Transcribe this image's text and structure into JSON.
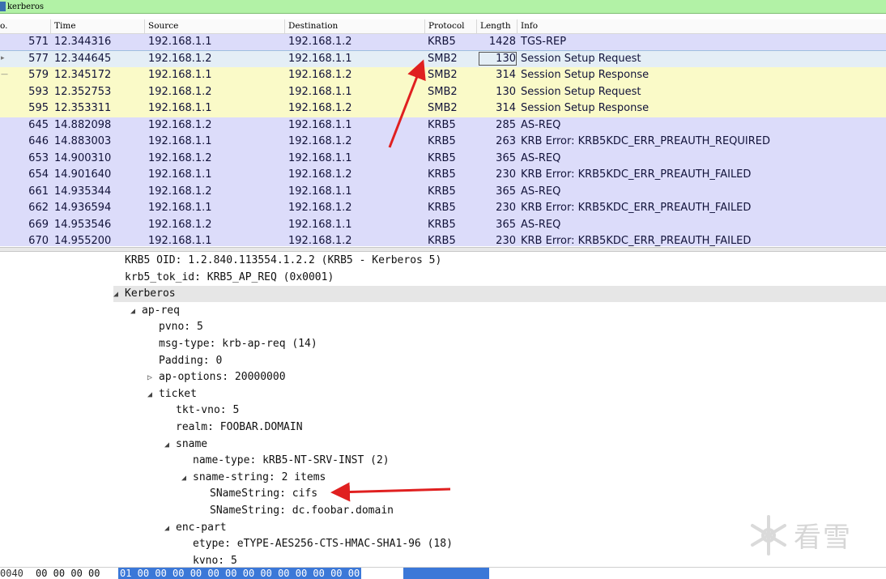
{
  "filter": {
    "value": "kerberos"
  },
  "columns": [
    {
      "label": "o."
    },
    {
      "label": "Time"
    },
    {
      "label": "Source"
    },
    {
      "label": "Destination"
    },
    {
      "label": "Protocol"
    },
    {
      "label": "Length"
    },
    {
      "label": "Info"
    }
  ],
  "packets": [
    {
      "no": "571",
      "time": "12.344316",
      "src": "192.168.1.1",
      "dst": "192.168.1.2",
      "proto": "KRB5",
      "len": "1428",
      "info": "TGS-REP",
      "bg": "#dcdcfa",
      "mark": ""
    },
    {
      "no": "577",
      "time": "12.344645",
      "src": "192.168.1.2",
      "dst": "192.168.1.1",
      "proto": "SMB2",
      "len": "130",
      "info": "Session Setup Request",
      "bg": "#e4eef6",
      "mark": "▸"
    },
    {
      "no": "579",
      "time": "12.345172",
      "src": "192.168.1.1",
      "dst": "192.168.1.2",
      "proto": "SMB2",
      "len": "314",
      "info": "Session Setup Response",
      "bg": "#fafac8",
      "mark": "—"
    },
    {
      "no": "593",
      "time": "12.352753",
      "src": "192.168.1.2",
      "dst": "192.168.1.1",
      "proto": "SMB2",
      "len": "130",
      "info": "Session Setup Request",
      "bg": "#fafac8",
      "mark": ""
    },
    {
      "no": "595",
      "time": "12.353311",
      "src": "192.168.1.1",
      "dst": "192.168.1.2",
      "proto": "SMB2",
      "len": "314",
      "info": "Session Setup Response",
      "bg": "#fafac8",
      "mark": ""
    },
    {
      "no": "645",
      "time": "14.882098",
      "src": "192.168.1.2",
      "dst": "192.168.1.1",
      "proto": "KRB5",
      "len": "285",
      "info": "AS-REQ",
      "bg": "#dcdcfa",
      "mark": ""
    },
    {
      "no": "646",
      "time": "14.883003",
      "src": "192.168.1.1",
      "dst": "192.168.1.2",
      "proto": "KRB5",
      "len": "263",
      "info": "KRB Error: KRB5KDC_ERR_PREAUTH_REQUIRED",
      "bg": "#dcdcfa",
      "mark": ""
    },
    {
      "no": "653",
      "time": "14.900310",
      "src": "192.168.1.2",
      "dst": "192.168.1.1",
      "proto": "KRB5",
      "len": "365",
      "info": "AS-REQ",
      "bg": "#dcdcfa",
      "mark": ""
    },
    {
      "no": "654",
      "time": "14.901640",
      "src": "192.168.1.1",
      "dst": "192.168.1.2",
      "proto": "KRB5",
      "len": "230",
      "info": "KRB Error: KRB5KDC_ERR_PREAUTH_FAILED",
      "bg": "#dcdcfa",
      "mark": ""
    },
    {
      "no": "661",
      "time": "14.935344",
      "src": "192.168.1.2",
      "dst": "192.168.1.1",
      "proto": "KRB5",
      "len": "365",
      "info": "AS-REQ",
      "bg": "#dcdcfa",
      "mark": ""
    },
    {
      "no": "662",
      "time": "14.936594",
      "src": "192.168.1.1",
      "dst": "192.168.1.2",
      "proto": "KRB5",
      "len": "230",
      "info": "KRB Error: KRB5KDC_ERR_PREAUTH_FAILED",
      "bg": "#dcdcfa",
      "mark": ""
    },
    {
      "no": "669",
      "time": "14.953546",
      "src": "192.168.1.2",
      "dst": "192.168.1.1",
      "proto": "KRB5",
      "len": "365",
      "info": "AS-REQ",
      "bg": "#dcdcfa",
      "mark": ""
    },
    {
      "no": "670",
      "time": "14.955200",
      "src": "192.168.1.1",
      "dst": "192.168.1.2",
      "proto": "KRB5",
      "len": "230",
      "info": "KRB Error: KRB5KDC_ERR_PREAUTH_FAILED",
      "bg": "#dcdcfa",
      "mark": ""
    }
  ],
  "selected_packet_no": "577",
  "tree": [
    {
      "text": "KRB5 OID: 1.2.840.113554.1.2.2 (KRB5 - Kerberos 5)",
      "depth": 0,
      "arrow": ""
    },
    {
      "text": "krb5_tok_id: KRB5_AP_REQ (0x0001)",
      "depth": 0,
      "arrow": ""
    },
    {
      "text": "Kerberos",
      "depth": 0,
      "arrow": "◢",
      "highlight": true
    },
    {
      "text": "ap-req",
      "depth": 1,
      "arrow": "◢"
    },
    {
      "text": "pvno: 5",
      "depth": 2,
      "arrow": ""
    },
    {
      "text": "msg-type: krb-ap-req (14)",
      "depth": 2,
      "arrow": ""
    },
    {
      "text": "Padding: 0",
      "depth": 2,
      "arrow": ""
    },
    {
      "text": "ap-options: 20000000",
      "depth": 2,
      "arrow": "▷"
    },
    {
      "text": "ticket",
      "depth": 2,
      "arrow": "◢"
    },
    {
      "text": "tkt-vno: 5",
      "depth": 3,
      "arrow": ""
    },
    {
      "text": "realm: FOOBAR.DOMAIN",
      "depth": 3,
      "arrow": ""
    },
    {
      "text": "sname",
      "depth": 3,
      "arrow": "◢"
    },
    {
      "text": "name-type: kRB5-NT-SRV-INST (2)",
      "depth": 4,
      "arrow": ""
    },
    {
      "text": "sname-string: 2 items",
      "depth": 4,
      "arrow": "◢"
    },
    {
      "text": "SNameString: cifs",
      "depth": 5,
      "arrow": ""
    },
    {
      "text": "SNameString: dc.foobar.domain",
      "depth": 5,
      "arrow": ""
    },
    {
      "text": "enc-part",
      "depth": 3,
      "arrow": "◢"
    },
    {
      "text": "etype: eTYPE-AES256-CTS-HMAC-SHA1-96 (18)",
      "depth": 4,
      "arrow": ""
    },
    {
      "text": "kvno: 5",
      "depth": 4,
      "arrow": ""
    }
  ],
  "hex": {
    "offset": "0040",
    "bytes": "00 00 00 00",
    "selected": "01 00 00 00 00 00 00 00 00 00 00 00 00 00"
  },
  "watermark": {
    "text": "看雪",
    "icon": "snowflake-icon"
  },
  "colors": {
    "annotation": "#e02020",
    "selection_hex": "#3b78d8"
  }
}
